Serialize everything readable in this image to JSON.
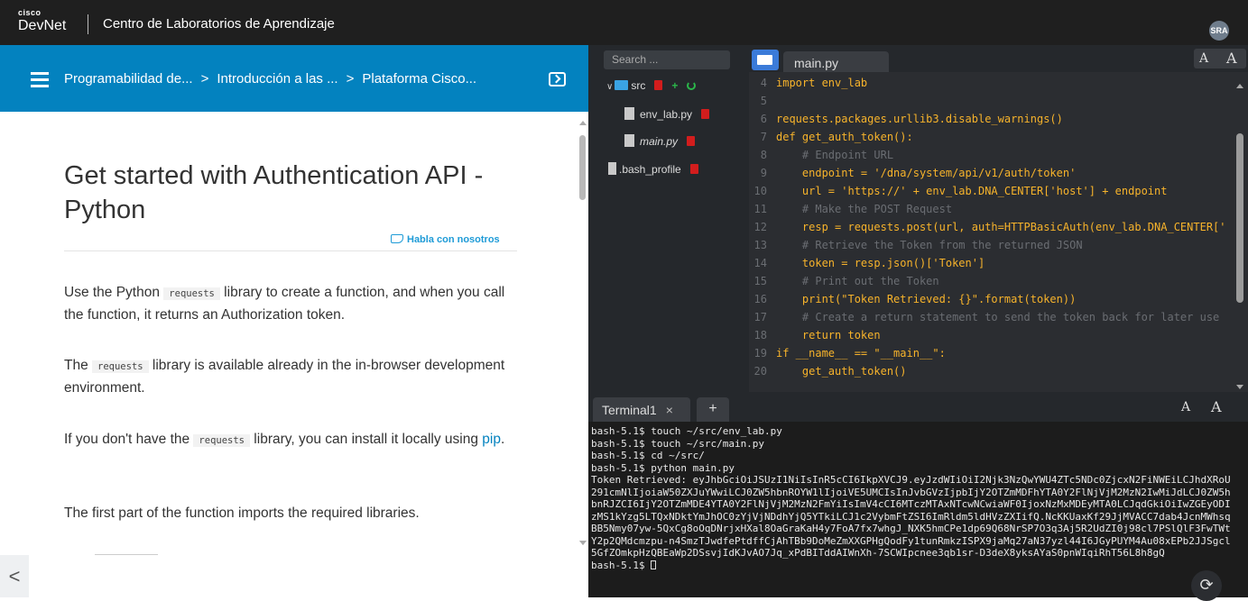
{
  "header": {
    "logo_top": "cisco",
    "logo_bottom": "DevNet",
    "title": "Centro de Laboratorios de Aprendizaje",
    "avatar": "SRA"
  },
  "breadcrumb": {
    "items": [
      "Programabilidad de...",
      "Introducción a las ...",
      "Plataforma Cisco..."
    ],
    "separator": ">"
  },
  "lesson": {
    "title": "Get started with Authentication API - Python",
    "talk_link": "Habla con nosotros",
    "p1_pre": "Use the Python ",
    "p1_code": "requests",
    "p1_post": " library to create a function, and when you call the function, it returns an Authorization token.",
    "p2_pre": "The ",
    "p2_code": "requests",
    "p2_post": " library is available already in the in-browser development environment.",
    "p3_pre": "If you don't have the ",
    "p3_code": "requests",
    "p3_mid": " library, you can install it locally using ",
    "p3_link": "pip",
    "p3_post": ".",
    "p4": "The first part of the function imports the required libraries.",
    "back": "<"
  },
  "filetree": {
    "search_placeholder": "Search ...",
    "folder": "src",
    "files": [
      "env_lab.py",
      "main.py",
      ".bash_profile"
    ],
    "plus": "+"
  },
  "editor": {
    "tab": "main.py",
    "font_smaller": "A",
    "font_larger": "A"
  },
  "code_lines": [
    {
      "n": "4",
      "t": "import env_lab"
    },
    {
      "n": "5",
      "t": ""
    },
    {
      "n": "6",
      "t": "requests.packages.urllib3.disable_warnings()"
    },
    {
      "n": "7",
      "t": "def get_auth_token():"
    },
    {
      "n": "8",
      "t": "    # Endpoint URL"
    },
    {
      "n": "9",
      "t": "    endpoint = '/dna/system/api/v1/auth/token'"
    },
    {
      "n": "10",
      "t": "    url = 'https://' + env_lab.DNA_CENTER['host'] + endpoint"
    },
    {
      "n": "11",
      "t": "    # Make the POST Request"
    },
    {
      "n": "12",
      "t": "    resp = requests.post(url, auth=HTTPBasicAuth(env_lab.DNA_CENTER['"
    },
    {
      "n": "13",
      "t": "    # Retrieve the Token from the returned JSON"
    },
    {
      "n": "14",
      "t": "    token = resp.json()['Token']"
    },
    {
      "n": "15",
      "t": "    # Print out the Token"
    },
    {
      "n": "16",
      "t": "    print(\"Token Retrieved: {}\".format(token))"
    },
    {
      "n": "17",
      "t": "    # Create a return statement to send the token back for later use"
    },
    {
      "n": "18",
      "t": "    return token"
    },
    {
      "n": "19",
      "t": "if __name__ == \"__main__\":"
    },
    {
      "n": "20",
      "t": "    get_auth_token()"
    }
  ],
  "terminal": {
    "tab": "Terminal1",
    "close": "×",
    "add": "+",
    "output": "bash-5.1$ touch ~/src/env_lab.py\nbash-5.1$ touch ~/src/main.py\nbash-5.1$ cd ~/src/\nbash-5.1$ python main.py\nToken Retrieved: eyJhbGciOiJSUzI1NiIsInR5cCI6IkpXVCJ9.eyJzdWIiOiI2Njk3NzQwYWU4ZTc5NDc0ZjcxN2FiNWEiLCJhdXRoU291cmNlIjoiaW50ZXJuYWwiLCJ0ZW5hbnROYW1lIjoiVE5UMCIsInJvbGVzIjpbIjY2OTZmMDFhYTA0Y2FlNjVjM2MzN2IwMiJdLCJ0ZW5hbnRJZCI6IjY2OTZmMDE4YTA0Y2FlNjVjM2MzN2FmYiIsImV4cCI6MTczMTAxNTcwNCwiaWF0IjoxNzMxMDEyMTA0LCJqdGkiOiIwZGEyODIzMS1kYzg5LTQxNDktYmJhOC0zYjVjNDdhYjQ5YTkiLCJ1c2VybmFtZSI6ImRldm5ldHVzZXIifQ.NcKKUaxKf29JjMVACC7dab4JcnMWhsqBB5Nmy07yw-5QxCg8oOqDNrjxHXal8OaGraKaH4y7FoA7fx7whgJ_NXK5hmCPe1dp69Q68NrSP7O3q3Aj5R2UdZI0j98cl7PSlQlF3FwTWtY2p2QMdcmzpu-n4SmzTJwdfePtdffCjAhTBb9DoMeZmXXGPHgQodFy1tunRmkzISPX9jaMq27aN37yzl44I6JGyPUYM4Au08xEPb2JJSgcl5GfZOmkpHzQBEaWp2DSsvjIdKJvAO7Jq_xPdBITddAIWnXh-7SCWIpcnee3qb1sr-D3deX8yksAYaS0pnWIqiRhT56L8h8gQ\nbash-5.1$ "
  },
  "colors": {
    "header_bg": "#1f1f1f",
    "breadcrumb_bg": "#0382bf",
    "editor_bg": "#2b2d31",
    "terminal_bg": "#1c1c1c",
    "keyword": "#f7b32b",
    "link": "#0382bf"
  },
  "icons": [
    "hamburger-icon",
    "terminal-toggle-icon",
    "megaphone-icon",
    "folder-icon",
    "file-icon",
    "trash-icon",
    "plus-icon",
    "refresh-icon",
    "reload-icon"
  ]
}
